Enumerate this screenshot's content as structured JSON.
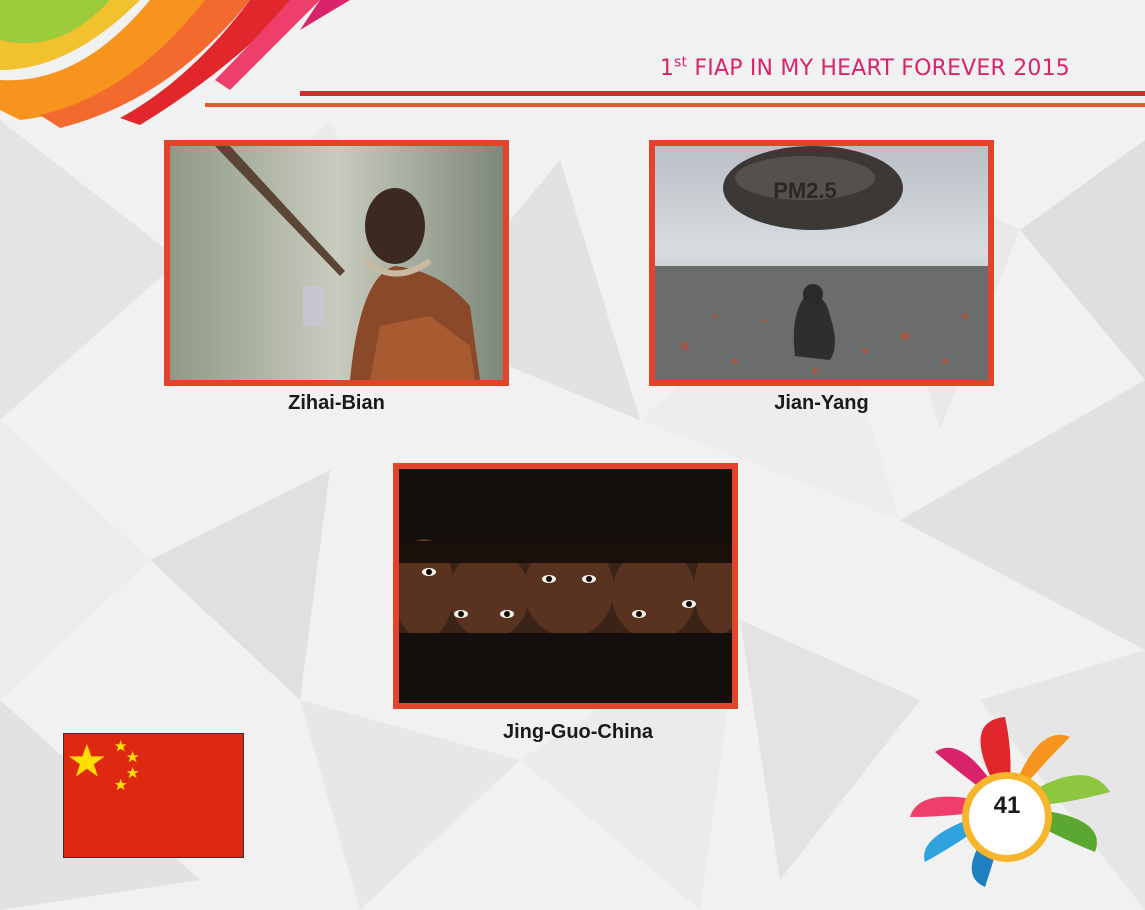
{
  "header": {
    "title_prefix": "1",
    "title_superscript": "st",
    "title_rest": " FIAP IN MY HEART FOREVER 2015",
    "title_color": "#d9246c",
    "rule_color": "#e2272c"
  },
  "photos": [
    {
      "caption": "Zihai-Bian",
      "frame_color": "#e2442b"
    },
    {
      "caption": "Jian-Yang",
      "overlay_text": "PM2.5",
      "frame_color": "#e2442b"
    },
    {
      "caption": "Jing-Guo-China",
      "frame_color": "#e2442b"
    }
  ],
  "flag": {
    "country": "China",
    "red": "#de2910",
    "yellow": "#ffde00"
  },
  "page": {
    "number": "41"
  }
}
